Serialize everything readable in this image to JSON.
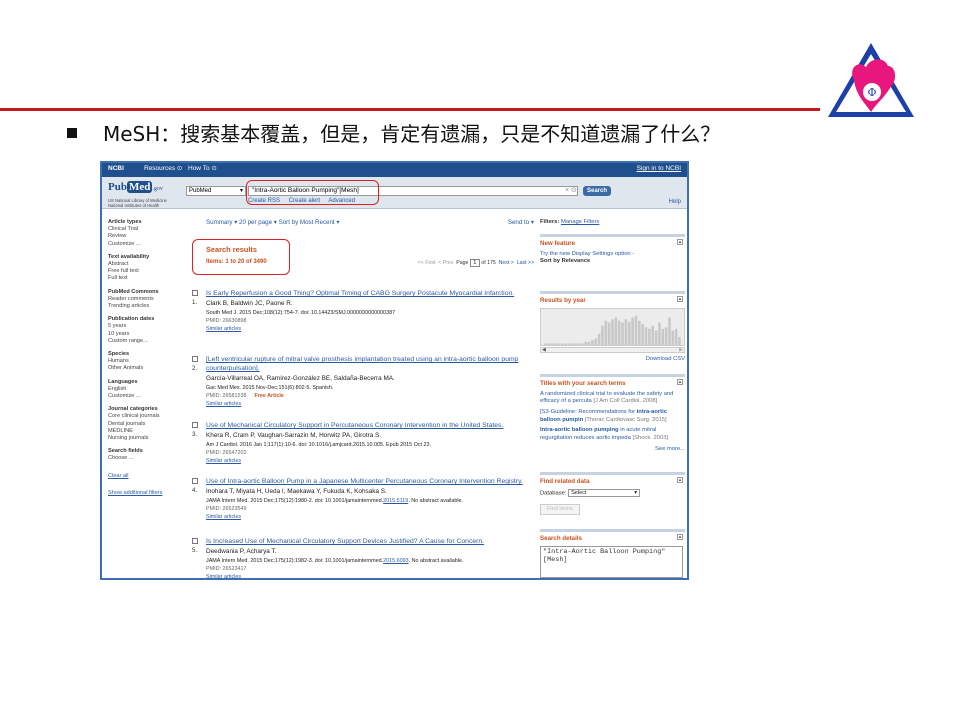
{
  "slide": {
    "bullet_text": "MeSH：搜索基本覆盖，但是，肯定有遗漏，只是不知道遗漏了什么？",
    "accent_color": "#c8161d",
    "frame_color": "#3e6fb0"
  },
  "ncbi_bar": {
    "logo": "NCBI",
    "resources": "Resources ⊙",
    "how_to": "How To ⊙",
    "sign_in": "Sign in to NCBI"
  },
  "search": {
    "brand_pub": "Pub",
    "brand_med": "Med",
    "brand_gov": ".gov",
    "nlm_line1": "US National Library of Medicine",
    "nlm_line2": "National Institutes of Health",
    "database": "PubMed",
    "query": "\"Intra-Aortic Balloon Pumping\"[Mesh]",
    "button": "Search",
    "rss": "Create RSS",
    "alert": "Create alert",
    "advanced": "Advanced",
    "help": "Help"
  },
  "left_filters": {
    "groups": [
      {
        "title": "Article types",
        "items": [
          "Clinical Trial",
          "Review",
          "Customize ..."
        ]
      },
      {
        "title": "Text availability",
        "items": [
          "Abstract",
          "Free full text",
          "Full text"
        ]
      },
      {
        "title": "PubMed Commons",
        "items": [
          "Reader comments",
          "Trending articles"
        ]
      },
      {
        "title": "Publication dates",
        "items": [
          "5 years",
          "10 years",
          "Custom range..."
        ]
      },
      {
        "title": "Species",
        "items": [
          "Humans",
          "Other Animals"
        ]
      },
      {
        "title": "Languages",
        "items": [
          "English",
          "Customize ..."
        ]
      },
      {
        "title": "Journal categories",
        "items": [
          "Core clinical journals",
          "Dental journals",
          "MEDLINE",
          "Nursing journals"
        ]
      },
      {
        "title": "Search fields",
        "items": [
          "Choose ..."
        ]
      }
    ],
    "clear_all": "Clear all",
    "show_additional": "Show additional filters"
  },
  "main": {
    "display_options": "Summary ▾  20 per page ▾  Sort by Most Recent ▾",
    "send_to": "Send to ▾",
    "results_title": "Search results",
    "items_count": "Items: 1 to 20 of 3490",
    "pager": {
      "first": "<< First",
      "prev": "< Prev",
      "page_label": "Page",
      "page_value": "1",
      "of_pages": "of 175",
      "next": "Next >",
      "last": "Last >>"
    },
    "results": [
      {
        "num": "1.",
        "title": "Is Early Reperfusion a Good Thing? Optimal Timing of CABG Surgery Postacute Myocardial Infarction.",
        "authors": "Clark B, Baldwin JC, Paone R.",
        "journal": "South Med J. 2015 Dec;108(12):754-7. doi: 10.14423/SMJ.0000000000000387",
        "journal_link": "",
        "journal_tail": "",
        "pmid": "PMID: 26630898",
        "free": "",
        "similar": "Similar articles"
      },
      {
        "num": "2.",
        "title": "[Left ventricular rupture of mitral valve prosthesis implantation treated using an intra-aortic balloon pump counterpulsation].",
        "authors": "García-Villarreal OA, Ramírez-González BE, Saldaña-Becerra MA.",
        "journal": "Gac Med Mex. 2015 Nov-Dec;151(6):802-5. Spanish.",
        "journal_link": "",
        "journal_tail": "",
        "pmid": "PMID: 26581538",
        "free": "Free Article",
        "similar": "Similar articles"
      },
      {
        "num": "3.",
        "title": "Use of Mechanical Circulatory Support in Percutaneous Coronary Intervention in the United States.",
        "authors": "Khera R, Cram P, Vaughan-Sarrazin M, Horwitz PA, Girotra S.",
        "journal": "Am J Cardiol. 2016 Jan 1;117(1):10-6. doi: 10.1016/j.amjcard.2015.10.005. Epub 2015 Oct 23.",
        "journal_link": "",
        "journal_tail": "",
        "pmid": "PMID: 26547202",
        "free": "",
        "similar": "Similar articles"
      },
      {
        "num": "4.",
        "title": "Use of Intra-aortic Balloon Pump in a Japanese Multicenter Percutaneous Coronary Intervention Registry.",
        "authors": "Inohara T, Miyata H, Ueda I, Maekawa Y, Fukuda K, Kohsaka S.",
        "journal": "JAMA Intern Med. 2015 Dec;175(12):1980-2. doi: 10.1001/jamainternmed.",
        "journal_link": "2015.5119",
        "journal_tail": ". No abstract available.",
        "pmid": "PMID: 26523549",
        "free": "",
        "similar": "Similar articles"
      },
      {
        "num": "5.",
        "title": "Is Increased Use of Mechanical Circulatory Support Devices Justified? A Cause for Concern.",
        "authors": "Deedwania P, Acharya T.",
        "journal": "JAMA Intern Med. 2015 Dec;175(12):1982-3. doi: 10.1001/jamainternmed.",
        "journal_link": "2015.6093",
        "journal_tail": ". No abstract available.",
        "pmid": "PMID: 26523417",
        "free": "",
        "similar": "Similar articles"
      }
    ]
  },
  "right": {
    "filters_label": "Filters:",
    "manage_filters": "Manage Filters",
    "new_feature": {
      "title": "New feature",
      "line1": "Try the new Display Settings option -",
      "line2": "Sort by Relevance"
    },
    "results_by_year": {
      "title": "Results by year",
      "download": "Download CSV",
      "bar_levels": [
        0.05,
        0.05,
        0.05,
        0.05,
        0.05,
        0.05,
        0.05,
        0.05,
        0.05,
        0.05,
        0.05,
        0.05,
        0.1,
        0.1,
        0.15,
        0.2,
        0.35,
        0.6,
        0.75,
        0.7,
        0.8,
        0.85,
        0.75,
        0.7,
        0.8,
        0.72,
        0.85,
        0.9,
        0.75,
        0.65,
        0.55,
        0.5,
        0.6,
        0.45,
        0.7,
        0.5,
        0.55,
        0.85,
        0.45,
        0.5,
        0.25
      ]
    },
    "titles_terms": {
      "title": "Titles with your search terms",
      "entries": [
        {
          "text": "A randomized clinical trial to evaluate the safety and efficacy of a percuta",
          "source": "[J Am Coll Cardiol. 2008]"
        },
        {
          "text_pre": "[S3-Guideline: Recommendations for ",
          "bold": "intra-aortic balloon pumpin",
          "source": "[Thorac Cardiovasc Surg. 2015]"
        },
        {
          "bold": "Intra-aortic balloon pumping",
          "text_post": " in acute mitral regurgitation reduces aortic impeda",
          "source": "[Shock. 2003]"
        }
      ],
      "see_more": "See more..."
    },
    "find_related": {
      "title": "Find related data",
      "db_label": "Database:",
      "db_value": "Select",
      "button": "Find items"
    },
    "search_details": {
      "title": "Search details",
      "query": "\"Intra-Aortic Balloon Pumping\"[Mesh]"
    }
  }
}
